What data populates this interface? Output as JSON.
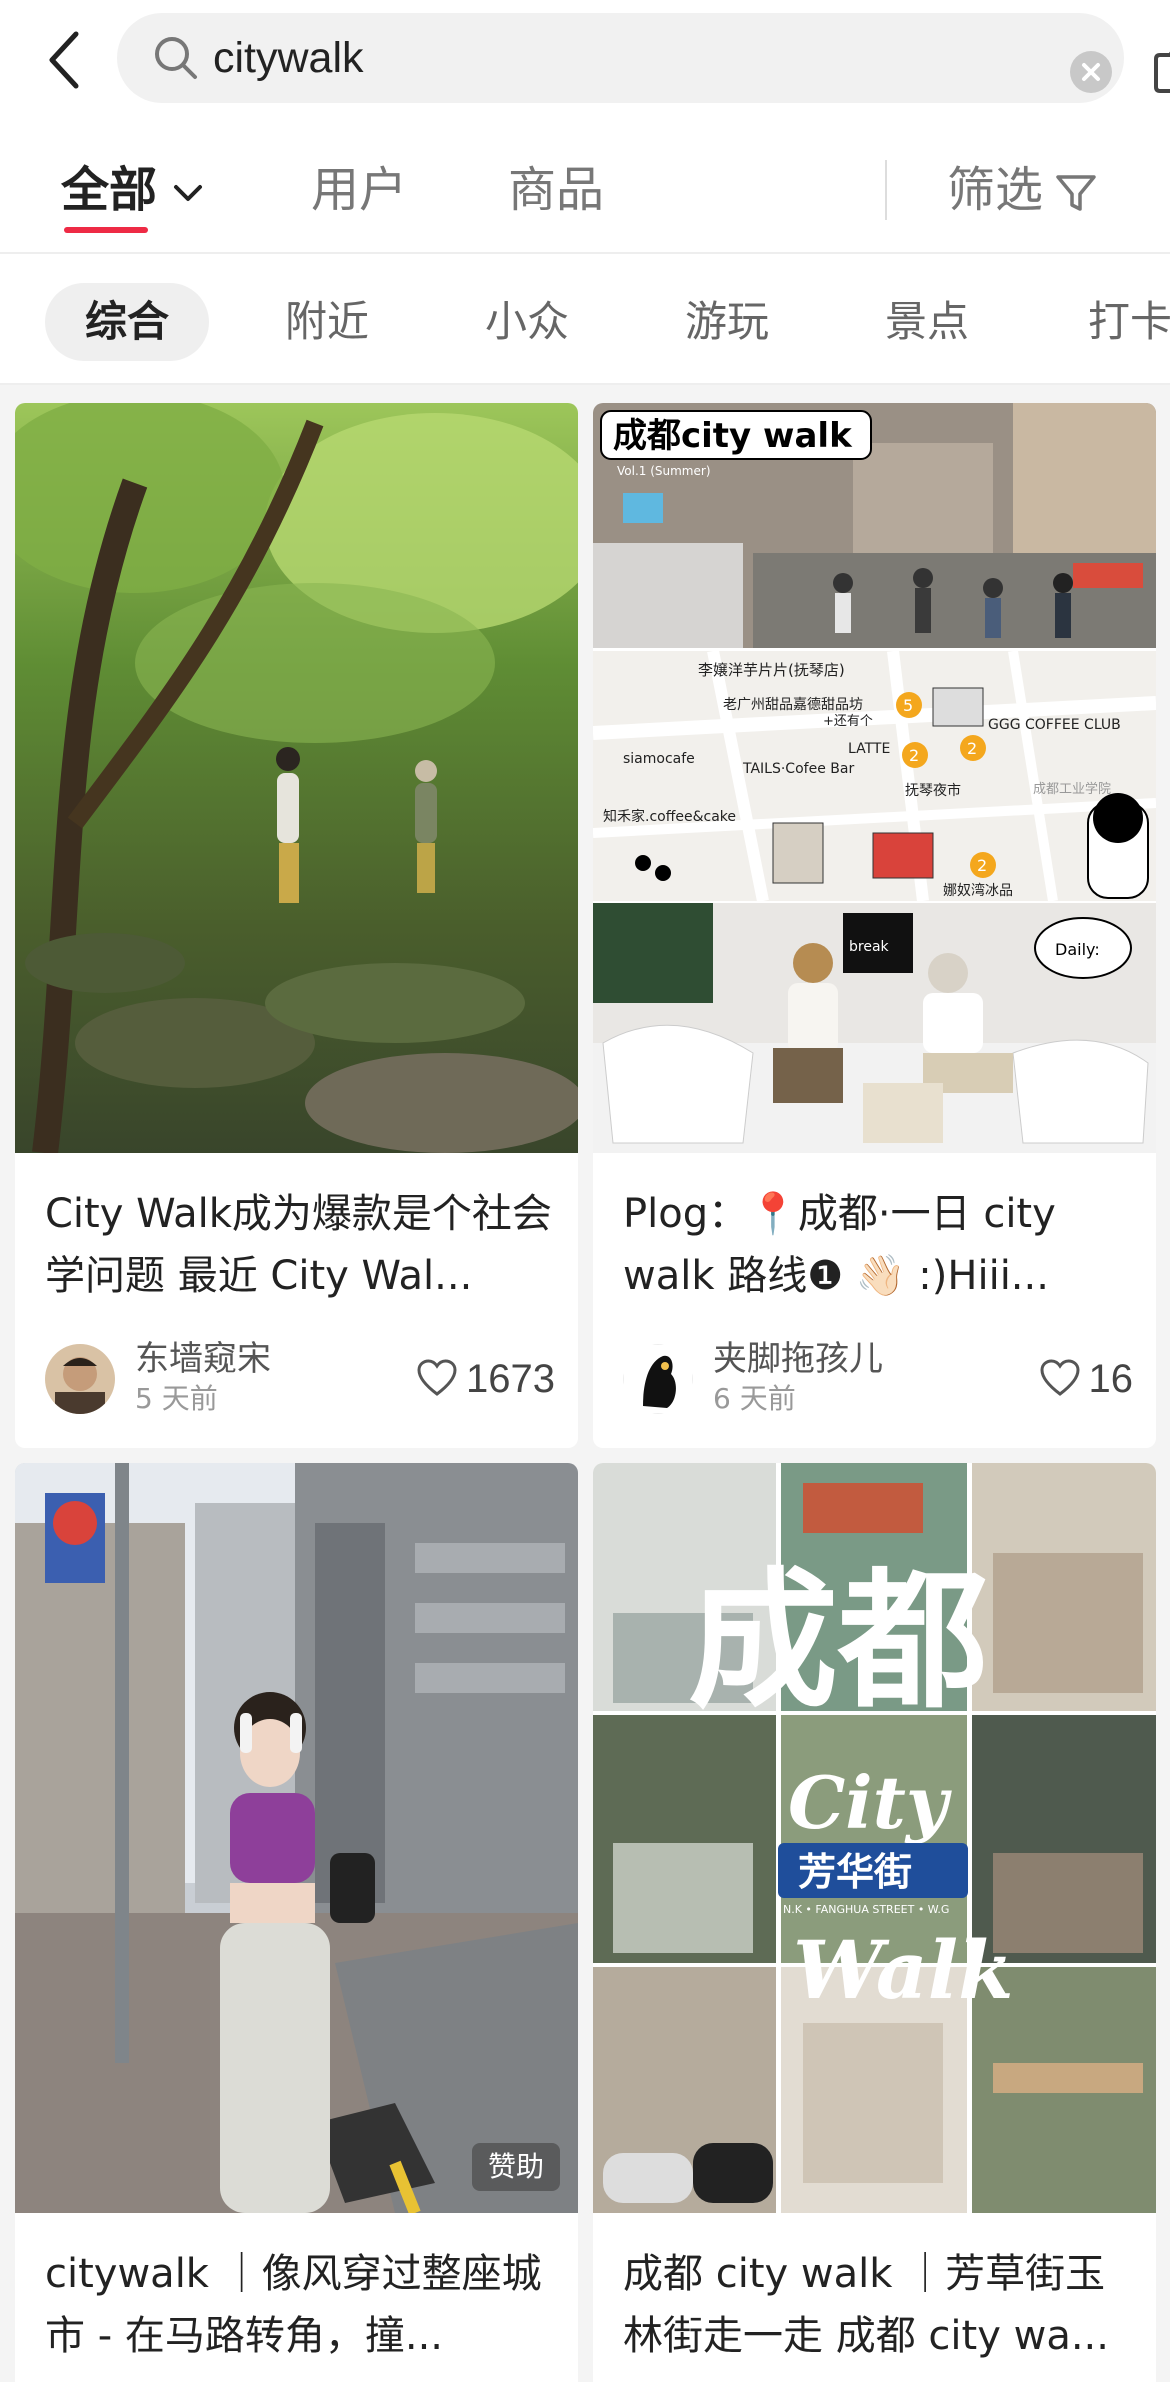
{
  "search": {
    "query": "citywalk"
  },
  "tabs": {
    "all": "全部",
    "users": "用户",
    "goods": "商品",
    "filter": "筛选"
  },
  "chips": [
    "综合",
    "附近",
    "小众",
    "游玩",
    "景点",
    "打卡"
  ],
  "accent_color": "#ee2a45",
  "cards": [
    {
      "title": "City Walk成为爆款是个社会学问题 最近 City Wal...",
      "author": "东墙窥宋",
      "time": "5 天前",
      "likes": "1673"
    },
    {
      "title": "Plog：📍成都·一日 city walk 路线❶ 👋🏻 :)Hiii...",
      "author": "夹脚拖孩儿",
      "time": "6 天前",
      "likes": "16",
      "cover_text": {
        "header": "成都city walk",
        "vol": "Vol.1 (Summer)",
        "shop1": "李嬢洋芋片片(抚琴店)",
        "shop2": "老广州甜品嘉德甜品坊",
        "plus": "+还有个",
        "latte": "LATTE",
        "ggg": "GGG COFFEE CLUB",
        "siamo": "siamocafe",
        "tails": "TAILS·Cofee Bar",
        "fuqin": "抚琴夜市",
        "zhihe": "知禾家.coffee&cake",
        "ice": "娜奴湾冰品",
        "factory": "成都工业学院",
        "daily": "Daily:",
        "break": "break"
      }
    },
    {
      "title": "citywalk ｜像风穿过整座城市 - 在马路转角，撞...",
      "sponsor": "赞助"
    },
    {
      "title": "成都 city walk ｜芳草街玉林街走一走 成都 city wa...",
      "cover_text": {
        "big1": "成都",
        "big2": "City",
        "big3": "Walk",
        "street": "芳华街",
        "street_en": "N.K • FANGHUA STREET • W.G"
      }
    }
  ]
}
